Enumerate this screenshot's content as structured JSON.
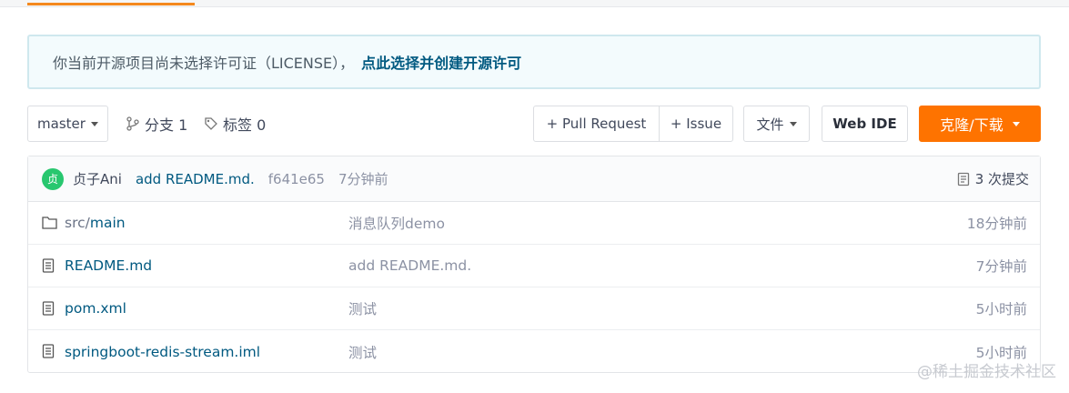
{
  "notice": {
    "message": "你当前开源项目尚未选择许可证（LICENSE），",
    "link": "点此选择并创建开源许可"
  },
  "toolbar": {
    "branch": "master",
    "branches_label": "分支 1",
    "tags_label": "标签 0",
    "pull_request": "+ Pull Request",
    "issue": "+ Issue",
    "files": "文件",
    "web_ide": "Web IDE",
    "clone": "克隆/下载"
  },
  "last_commit": {
    "avatar_text": "贞",
    "author": "贞子Ani",
    "message": "add README.md.",
    "sha": "f641e65",
    "time": "7分钟前",
    "commits": "3 次提交"
  },
  "files": [
    {
      "prefix": "src/",
      "name": "main",
      "type": "folder",
      "message": "消息队列demo",
      "time": "18分钟前"
    },
    {
      "prefix": "",
      "name": "README.md",
      "type": "file",
      "message": "add README.md.",
      "time": "7分钟前"
    },
    {
      "prefix": "",
      "name": "pom.xml",
      "type": "file",
      "message": "测试",
      "time": "5小时前"
    },
    {
      "prefix": "",
      "name": "springboot-redis-stream.iml",
      "type": "file",
      "message": "测试",
      "time": "5小时前"
    }
  ],
  "watermark": "@稀土掘金技术社区",
  "colors": {
    "accent": "#fe7300",
    "link": "#005980",
    "tab_active": "#f4891e"
  }
}
